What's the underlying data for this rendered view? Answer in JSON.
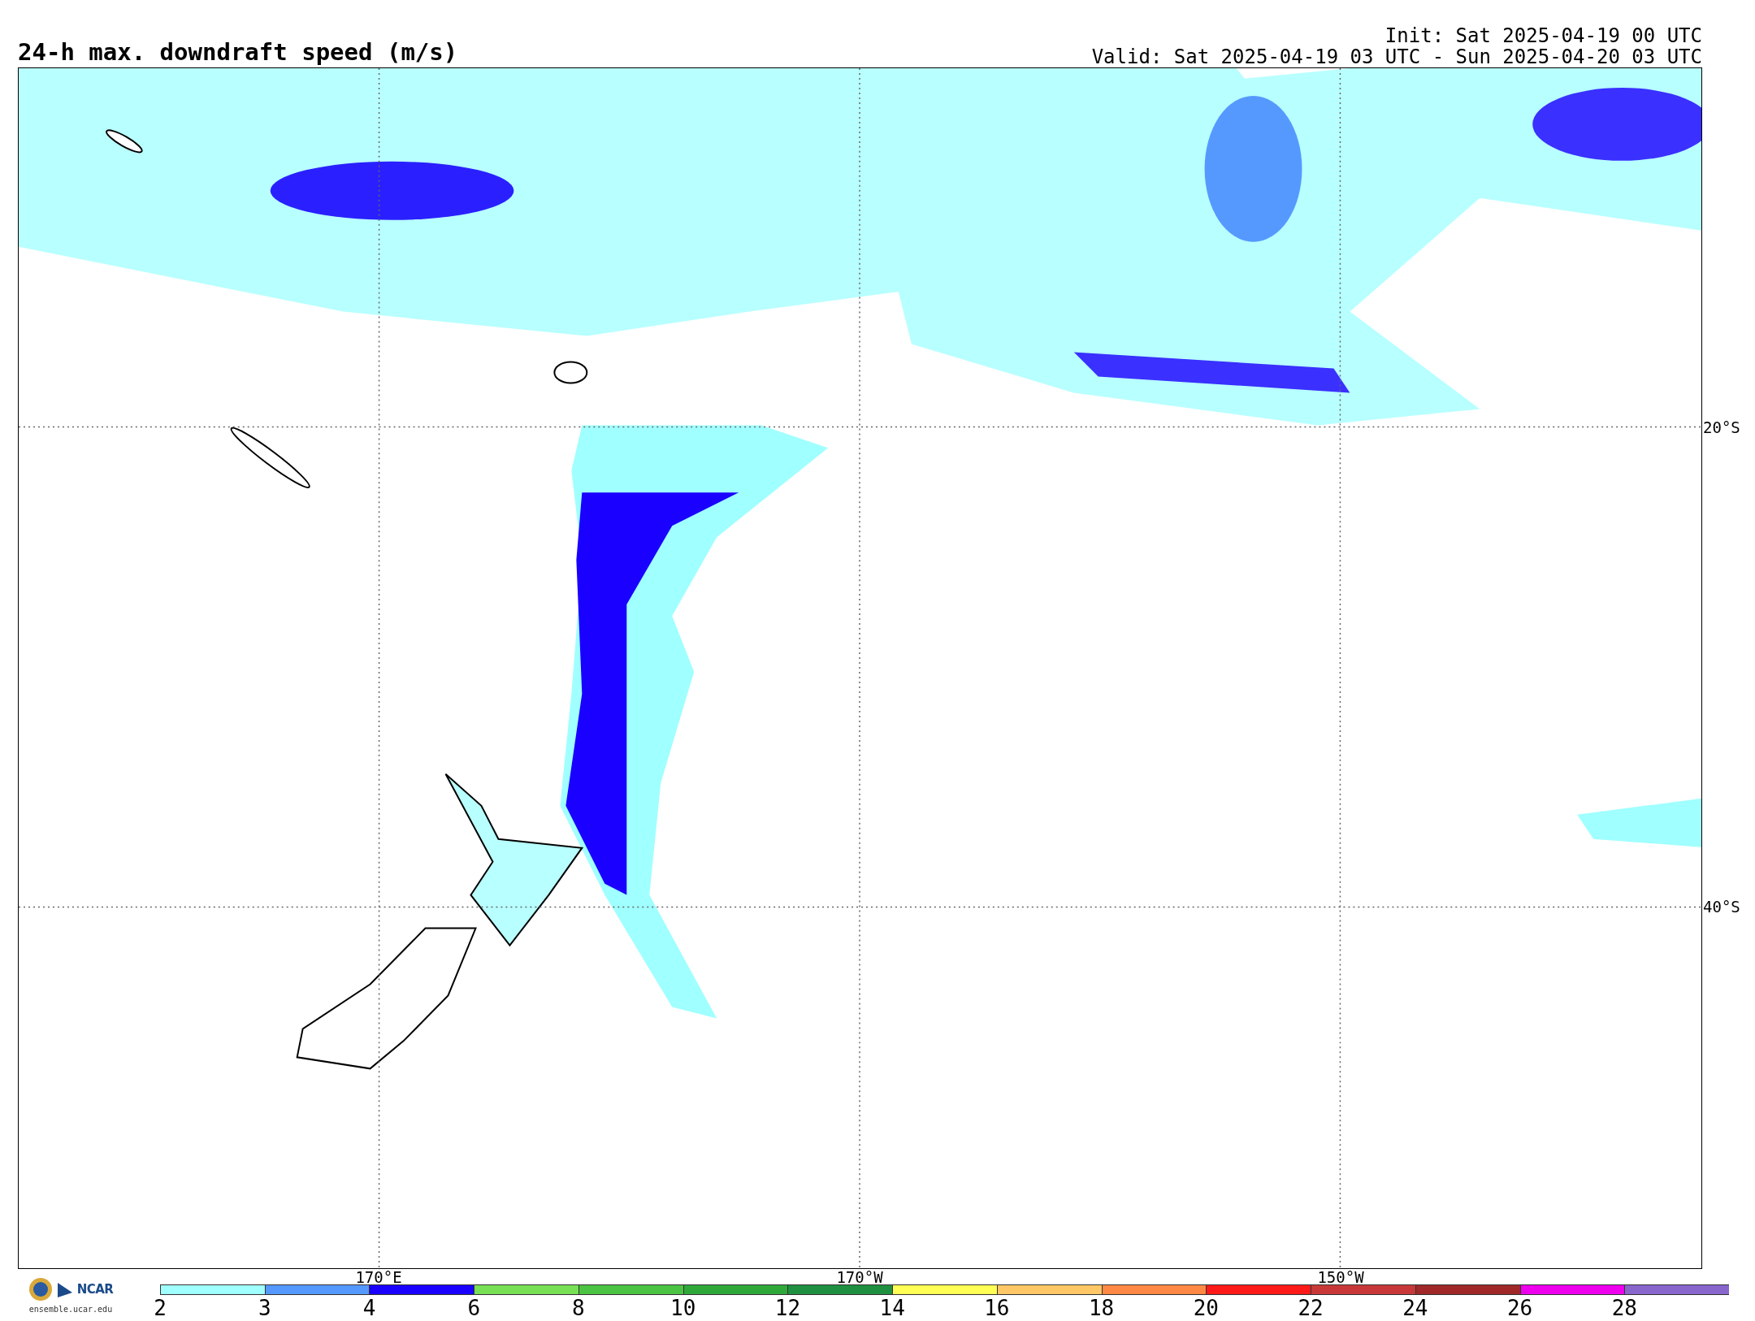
{
  "title": "24-h max. downdraft speed (m/s)",
  "init": "Init: Sat 2025-04-19 00 UTC",
  "valid": "Valid: Sat 2025-04-19 03 UTC - Sun 2025-04-20 03 UTC",
  "latitude_labels": [
    "20°S",
    "40°S"
  ],
  "longitude_labels": [
    "170°E",
    "170°W",
    "150°W"
  ],
  "logo": {
    "text": "NCAR",
    "url": "ensemble.ucar.edu"
  },
  "legend": [
    {
      "label": "2",
      "color": "#a0ffff"
    },
    {
      "label": "3",
      "color": "#5599ff"
    },
    {
      "label": "4",
      "color": "#1a00ff"
    },
    {
      "label": "6",
      "color": "#77e055"
    },
    {
      "label": "8",
      "color": "#4cc443"
    },
    {
      "label": "10",
      "color": "#2fa83a"
    },
    {
      "label": "12",
      "color": "#1f8f40"
    },
    {
      "label": "14",
      "color": "#ffff55"
    },
    {
      "label": "16",
      "color": "#ffc766"
    },
    {
      "label": "18",
      "color": "#ff8844"
    },
    {
      "label": "20",
      "color": "#ff1a1a"
    },
    {
      "label": "22",
      "color": "#c83838"
    },
    {
      "label": "24",
      "color": "#a02828"
    },
    {
      "label": "26",
      "color": "#ee00ee"
    },
    {
      "label": "28",
      "color": "#8866cc"
    }
  ]
}
